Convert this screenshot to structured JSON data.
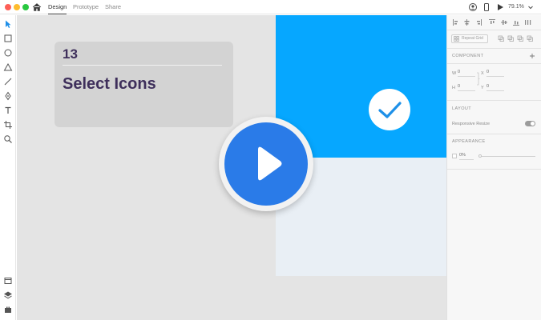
{
  "window": {
    "traffic_lights": {
      "close": "#fe5f57",
      "minimize": "#febc2e",
      "zoom": "#28c840"
    }
  },
  "tabs": [
    {
      "label": "Design",
      "active": true
    },
    {
      "label": "Prototype",
      "active": false
    },
    {
      "label": "Share",
      "active": false
    }
  ],
  "toolbar": {
    "zoom_level": "79.1%",
    "icons": [
      "user-icon",
      "mobile-preview-icon",
      "play-icon",
      "chevron-down-icon"
    ]
  },
  "left_tools": [
    "select-arrow-icon",
    "rectangle-icon",
    "ellipse-icon",
    "triangle-icon",
    "line-icon",
    "pen-icon",
    "text-icon",
    "artboard-icon",
    "zoom-icon",
    "assets-icon",
    "layers-icon",
    "plugins-icon"
  ],
  "canvas": {
    "card": {
      "number": "13",
      "title": "Select Icons"
    },
    "artboard_color": "#06a7ff",
    "play_color": "#2a7be8"
  },
  "right_panel": {
    "repeat_grid_label": "Repeat Grid",
    "component_label": "COMPONENT",
    "fields": [
      {
        "key": "W",
        "value": "0"
      },
      {
        "key": "X",
        "value": "0"
      },
      {
        "key": "H",
        "value": "0"
      },
      {
        "key": "Y",
        "value": "0"
      }
    ],
    "layout_label": "LAYOUT",
    "responsive_resize_label": "Responsive Resize",
    "appearance_label": "APPEARANCE",
    "opacity_value": "0%"
  }
}
